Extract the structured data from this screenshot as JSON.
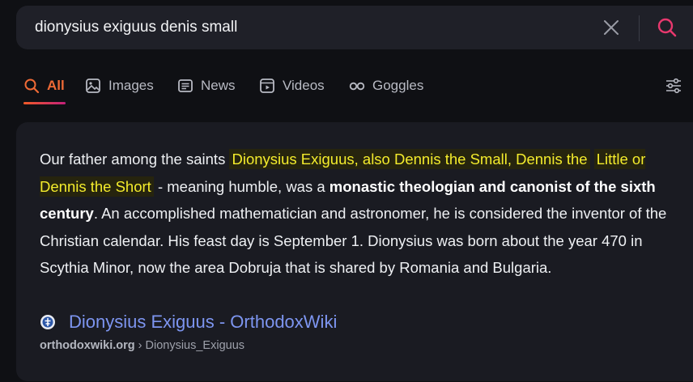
{
  "search": {
    "query": "dionysius exiguus denis small"
  },
  "tabs": [
    {
      "label": "All",
      "icon": "search-icon",
      "active": true
    },
    {
      "label": "Images",
      "icon": "image-icon"
    },
    {
      "label": "News",
      "icon": "news-icon"
    },
    {
      "label": "Videos",
      "icon": "video-icon"
    },
    {
      "label": "Goggles",
      "icon": "goggles-icon"
    }
  ],
  "result": {
    "snippet": {
      "pre": "Our father among the saints ",
      "highlight_line1": "Dionysius Exiguus, also Dennis the Small, Dennis the",
      "highlight_line2": "Little or Dennis the Short",
      "mid": " - meaning humble, was a ",
      "bold": "monastic theologian and canonist of the sixth century",
      "post": ". An accomplished mathematician and astronomer, he is considered the inventor of the Christian calendar. His feast day is September 1. Dionysius was born about the year 470 in Scythia Minor, now the area Dobruja that is shared by Romania and Bulgaria."
    },
    "title": "Dionysius Exiguus - OrthodoxWiki",
    "url_domain": "orthodoxwiki.org",
    "url_separator": " › ",
    "url_path": "Dionysius_Exiguus"
  },
  "colors": {
    "accent": "#ef6a36",
    "highlight_text": "#f4ec2c",
    "link": "#7d95f0",
    "background": "#0f1014",
    "card": "#1a1b22"
  }
}
